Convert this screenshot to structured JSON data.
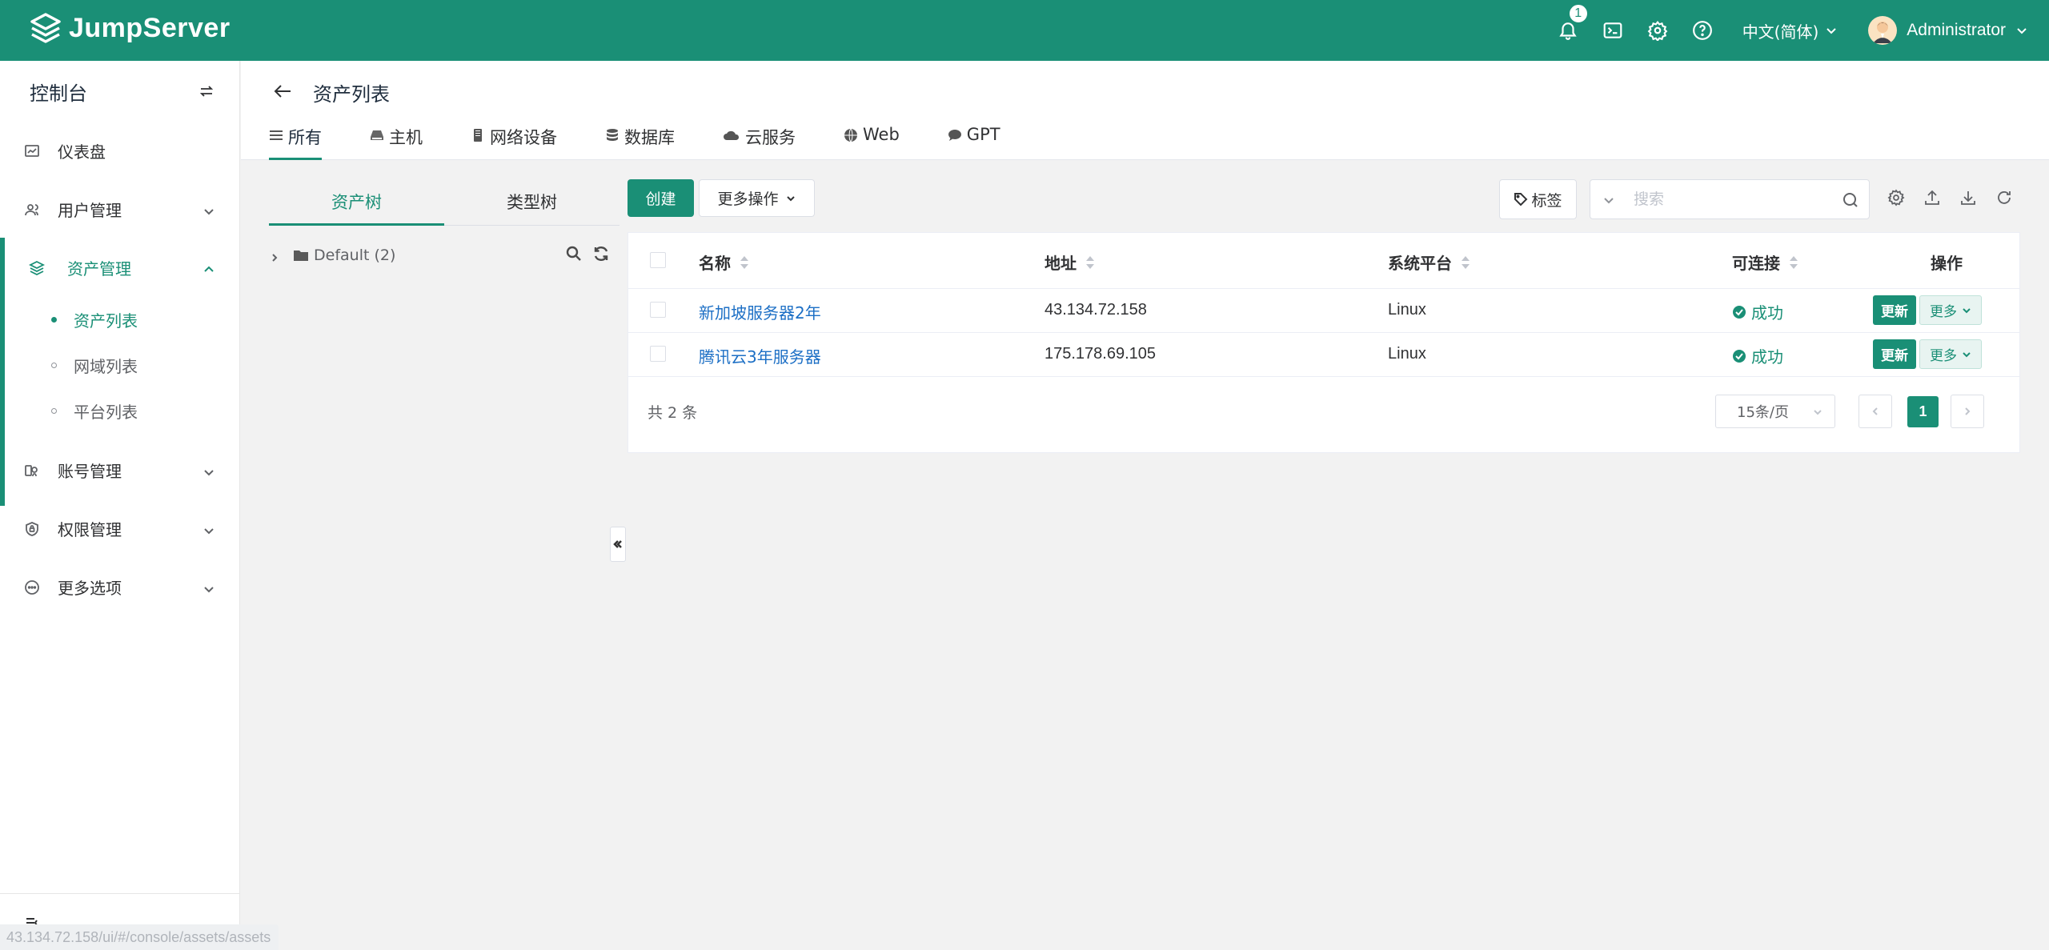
{
  "app": {
    "name": "JumpServer"
  },
  "topbar": {
    "notification_count": "1",
    "language": "中文(简体)",
    "username": "Administrator"
  },
  "sidebar": {
    "title": "控制台",
    "items": [
      {
        "label": "仪表盘"
      },
      {
        "label": "用户管理"
      },
      {
        "label": "资产管理"
      },
      {
        "label": "账号管理"
      },
      {
        "label": "权限管理"
      },
      {
        "label": "更多选项"
      }
    ],
    "sub_items": [
      {
        "label": "资产列表"
      },
      {
        "label": "网域列表"
      },
      {
        "label": "平台列表"
      }
    ]
  },
  "status_url": "43.134.72.158/ui/#/console/assets/assets",
  "page": {
    "title": "资产列表",
    "tabs": [
      {
        "label": "所有"
      },
      {
        "label": "主机"
      },
      {
        "label": "网络设备"
      },
      {
        "label": "数据库"
      },
      {
        "label": "云服务"
      },
      {
        "label": "Web"
      },
      {
        "label": "GPT"
      }
    ]
  },
  "tree": {
    "tabs": [
      {
        "label": "资产树"
      },
      {
        "label": "类型树"
      }
    ],
    "root_label": "Default (2)"
  },
  "toolbar": {
    "create_label": "创建",
    "more_ops_label": "更多操作",
    "tag_label": "标签",
    "search_placeholder": "搜索"
  },
  "table": {
    "columns": [
      {
        "label": "名称"
      },
      {
        "label": "地址"
      },
      {
        "label": "系统平台"
      },
      {
        "label": "可连接"
      },
      {
        "label": "操作"
      }
    ],
    "rows": [
      {
        "name": "新加坡服务器2年",
        "address": "43.134.72.158",
        "platform": "Linux",
        "connectivity": "成功",
        "update_label": "更新",
        "more_label": "更多"
      },
      {
        "name": "腾讯云3年服务器",
        "address": "175.178.69.105",
        "platform": "Linux",
        "connectivity": "成功",
        "update_label": "更新",
        "more_label": "更多"
      }
    ]
  },
  "pagination": {
    "total_text": "共 2 条",
    "page_size": "15条/页",
    "current_page": "1"
  },
  "colors": {
    "brand": "#1a8f76",
    "link": "#1c6fc5"
  }
}
